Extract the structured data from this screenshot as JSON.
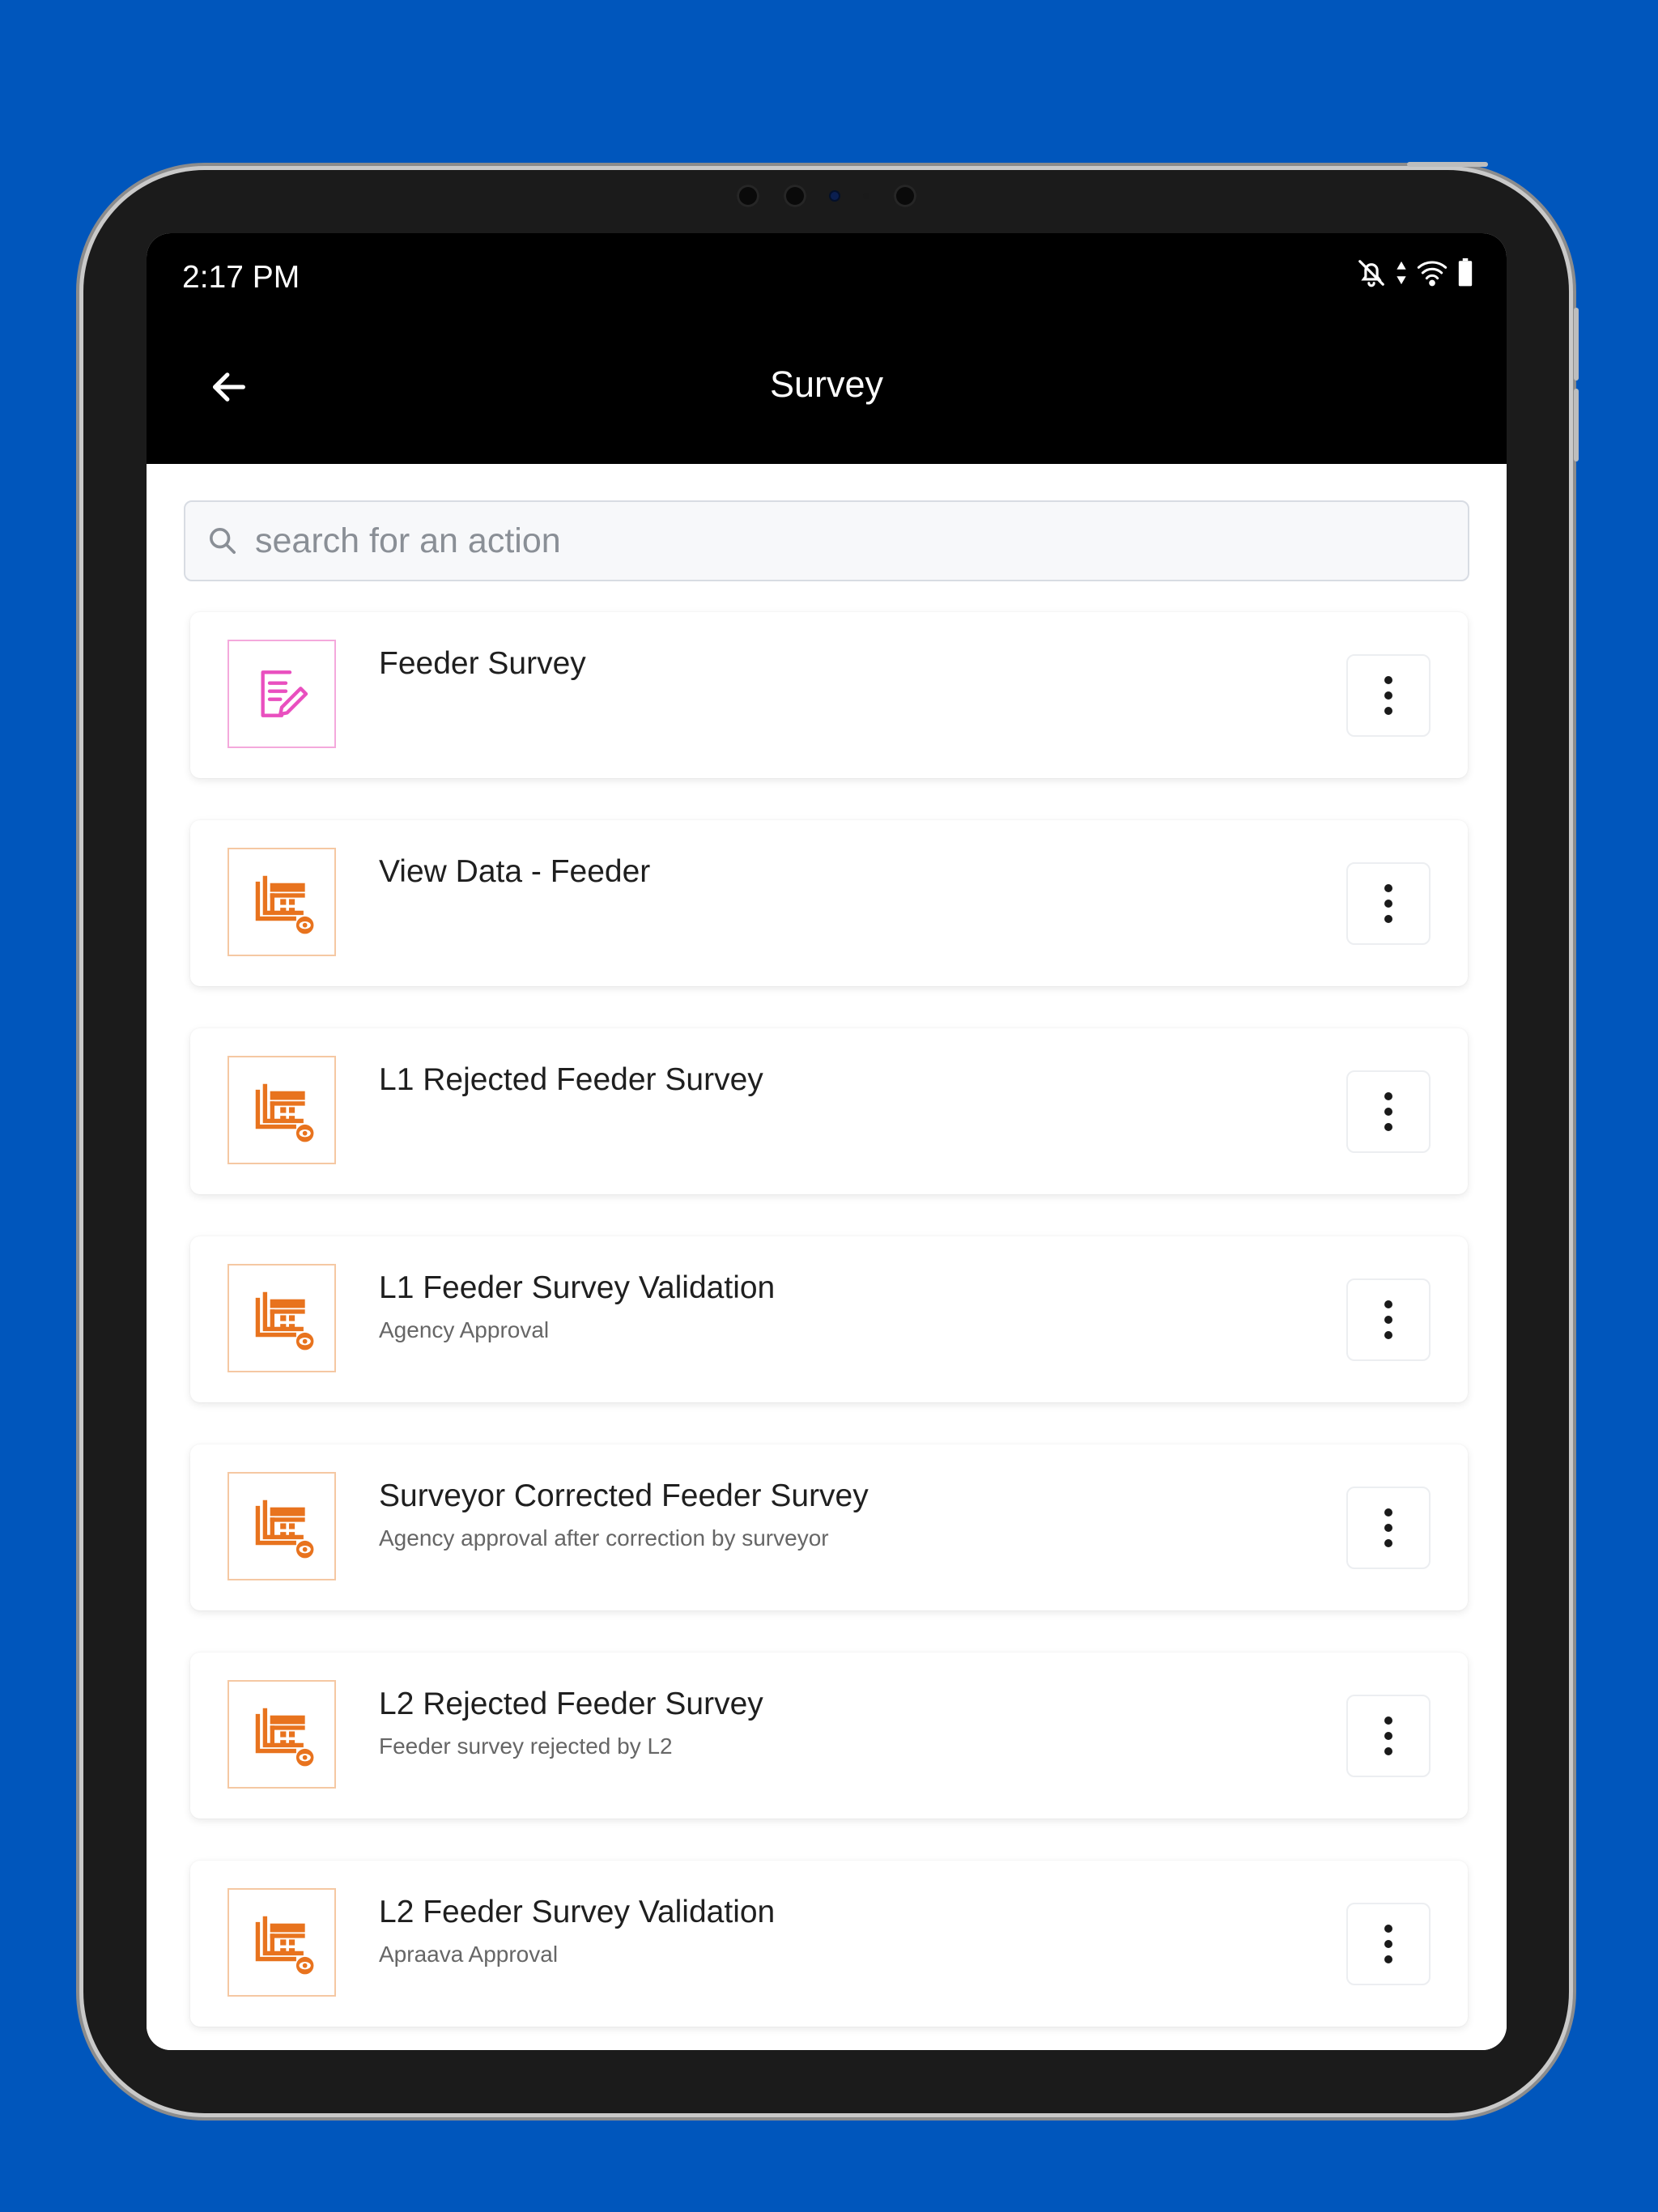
{
  "status_bar": {
    "time": "2:17 PM",
    "icons": [
      "bell-off-icon",
      "data-arrows-icon",
      "wifi-icon",
      "battery-icon"
    ]
  },
  "app_bar": {
    "title": "Survey",
    "back_icon": "arrow-left-icon"
  },
  "search": {
    "placeholder": "search for an action",
    "value": "",
    "icon": "search-icon"
  },
  "colors": {
    "background": "#0056BC",
    "header": "#000000",
    "pink_accent": "#E94FBF",
    "orange_accent": "#E8731E"
  },
  "actions": [
    {
      "title": "Feeder Survey",
      "subtitle": "",
      "icon": "form-edit-icon",
      "icon_color": "pink"
    },
    {
      "title": "View Data - Feeder",
      "subtitle": "",
      "icon": "table-view-icon",
      "icon_color": "orange"
    },
    {
      "title": "L1 Rejected Feeder Survey",
      "subtitle": "",
      "icon": "table-view-icon",
      "icon_color": "orange"
    },
    {
      "title": "L1 Feeder Survey Validation",
      "subtitle": "Agency Approval",
      "icon": "table-view-icon",
      "icon_color": "orange"
    },
    {
      "title": "Surveyor Corrected Feeder Survey",
      "subtitle": "Agency approval after correction by surveyor",
      "icon": "table-view-icon",
      "icon_color": "orange"
    },
    {
      "title": "L2 Rejected Feeder Survey",
      "subtitle": "Feeder survey rejected by L2",
      "icon": "table-view-icon",
      "icon_color": "orange"
    },
    {
      "title": "L2 Feeder Survey Validation",
      "subtitle": "Apraava Approval",
      "icon": "table-view-icon",
      "icon_color": "orange"
    }
  ]
}
